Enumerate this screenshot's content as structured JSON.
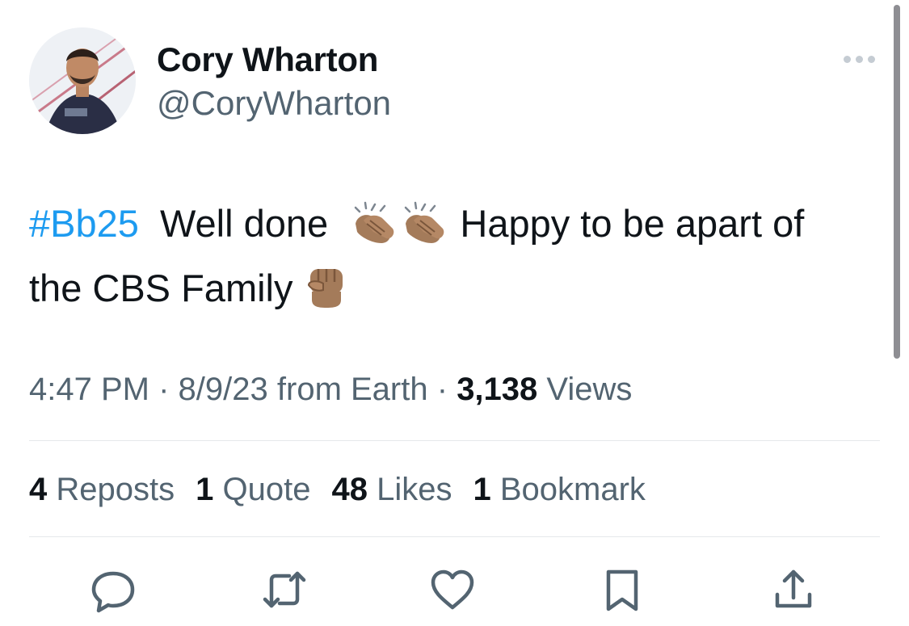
{
  "author": {
    "display_name": "Cory Wharton",
    "handle": "@CoryWharton"
  },
  "tweet": {
    "hashtag": "#Bb25",
    "text_part1": "Well done",
    "text_part2": "Happy to be apart of",
    "text_part3": "the CBS Family",
    "emojis": [
      "clapping-hands-emoji",
      "clapping-hands-emoji",
      "raised-fist-emoji"
    ]
  },
  "meta": {
    "time": "4:47 PM",
    "date": "8/9/23",
    "source": "from Earth",
    "separator": "·",
    "views_count": "3,138",
    "views_label": "Views"
  },
  "stats": [
    {
      "count": "4",
      "label": "Reposts"
    },
    {
      "count": "1",
      "label": "Quote"
    },
    {
      "count": "48",
      "label": "Likes"
    },
    {
      "count": "1",
      "label": "Bookmark"
    }
  ],
  "actions": [
    "reply-icon",
    "retweet-icon",
    "like-icon",
    "bookmark-icon",
    "share-icon"
  ],
  "colors": {
    "link": "#1d9bf0",
    "secondary_text": "#536471",
    "primary_text": "#0f1419",
    "divider": "#e5e8eb"
  }
}
